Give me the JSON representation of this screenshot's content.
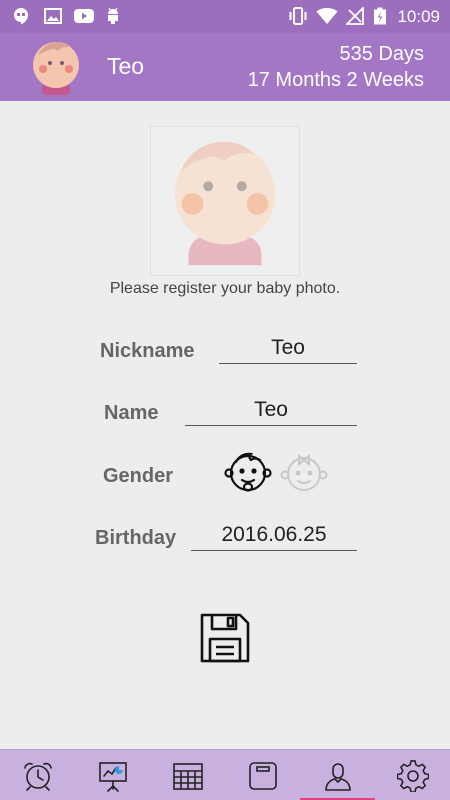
{
  "status_bar": {
    "time": "10:09",
    "left_icons": [
      "hangouts-icon",
      "gallery-icon",
      "youtube-icon",
      "android-debug-icon"
    ],
    "right_icons": [
      "vibrate-icon",
      "wifi-icon",
      "signal-icon",
      "battery-icon"
    ]
  },
  "header": {
    "baby_name": "Teo",
    "days": "535 Days",
    "age": "17 Months 2 Weeks"
  },
  "photo": {
    "hint": "Please register your baby photo."
  },
  "form": {
    "nickname_label": "Nickname",
    "nickname_value": "Teo",
    "name_label": "Name",
    "name_value": "Teo",
    "gender_label": "Gender",
    "gender_selected": "boy",
    "birthday_label": "Birthday",
    "birthday_value": "2016.06.25"
  },
  "bottom_nav": {
    "items": [
      "alarm-clock-icon",
      "presentation-chart-icon",
      "calendar-icon",
      "scale-icon",
      "profile-icon",
      "settings-icon"
    ],
    "active": "profile-icon"
  },
  "colors": {
    "status_bar": "#9b6fbe",
    "header": "#a477c6",
    "bottom_nav": "#c8b0df",
    "active_indicator": "#e6407c"
  }
}
